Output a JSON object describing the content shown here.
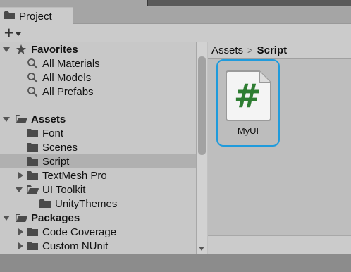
{
  "tab": {
    "label": "Project",
    "icon": "folder-icon"
  },
  "toolbar": {
    "create_label": "+",
    "create_icon": "plus-icon"
  },
  "tree": {
    "favorites": {
      "label": "Favorites",
      "items": [
        "All Materials",
        "All Models",
        "All Prefabs"
      ]
    },
    "assets": {
      "label": "Assets",
      "items": {
        "font": "Font",
        "scenes": "Scenes",
        "script": "Script",
        "textmesh": "TextMesh Pro",
        "uitoolkit": "UI Toolkit",
        "unitythemes": "UnityThemes"
      }
    },
    "packages": {
      "label": "Packages",
      "items": [
        "Code Coverage",
        "Custom NUnit"
      ]
    },
    "selected": "Script"
  },
  "breadcrumb": {
    "root": "Assets",
    "separator": ">",
    "current": "Script"
  },
  "assets_grid": [
    {
      "name": "MyUI",
      "icon": "csharp-script-icon",
      "symbol": "#"
    }
  ],
  "colors": {
    "selection_border": "#1f9bdc",
    "script_hash": "#2e7d32"
  }
}
